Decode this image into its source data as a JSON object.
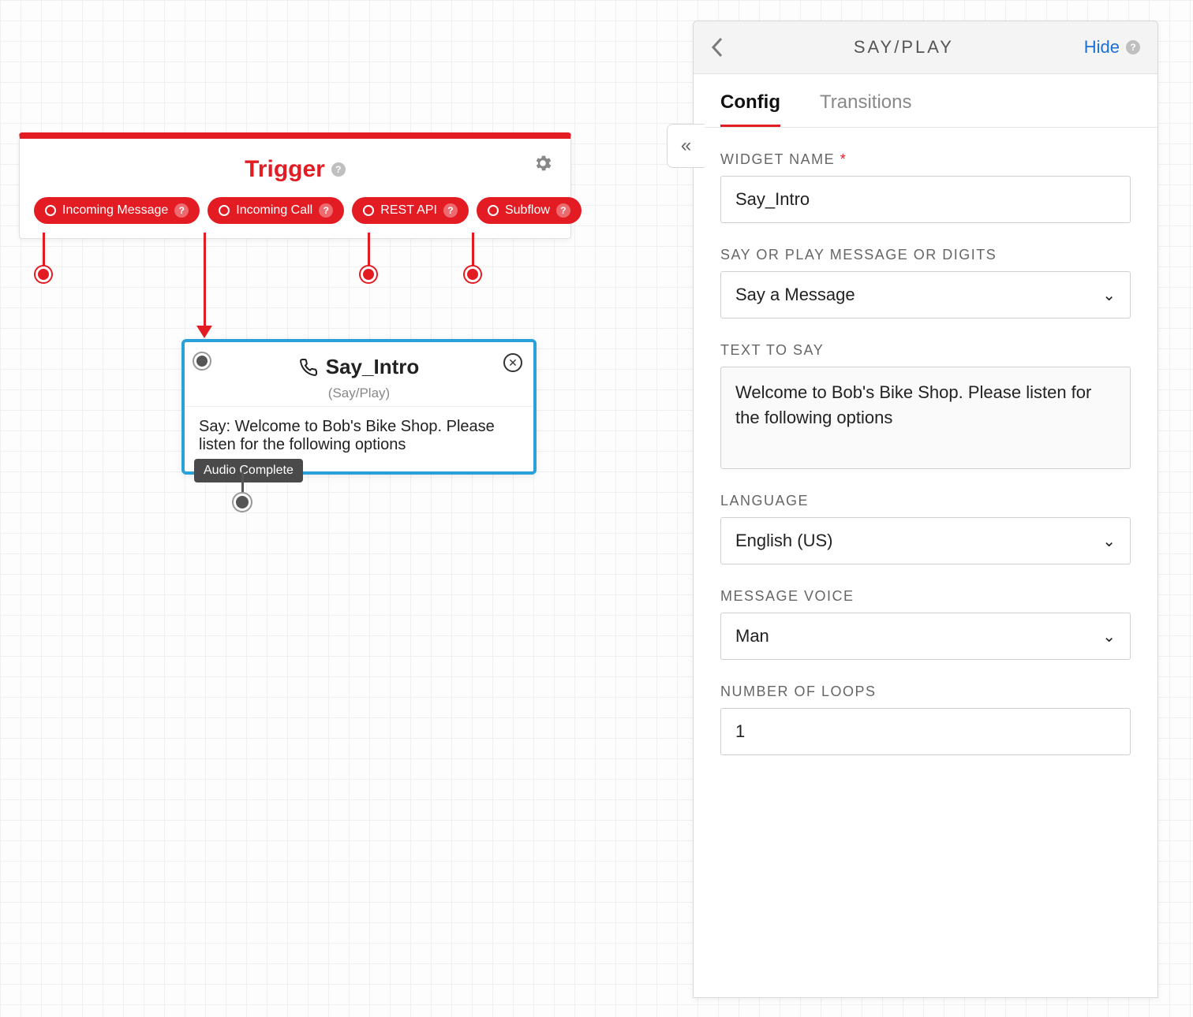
{
  "colors": {
    "accent": "#e31b23",
    "selected": "#2aa1d8",
    "link": "#1d6fd6"
  },
  "canvas": {
    "trigger": {
      "title": "Trigger",
      "events": [
        {
          "label": "Incoming Message"
        },
        {
          "label": "Incoming Call"
        },
        {
          "label": "REST API"
        },
        {
          "label": "Subflow"
        }
      ]
    },
    "say_widget": {
      "title": "Say_Intro",
      "subtitle": "(Say/Play)",
      "body": "Say: Welcome to Bob's Bike Shop. Please listen for the following options",
      "out_label": "Audio Complete"
    }
  },
  "panel": {
    "title": "SAY/PLAY",
    "hide": "Hide",
    "tabs": {
      "config": "Config",
      "transitions": "Transitions"
    },
    "form": {
      "widget_name_label": "WIDGET NAME",
      "widget_name_value": "Say_Intro",
      "mode_label": "SAY OR PLAY MESSAGE OR DIGITS",
      "mode_value": "Say a Message",
      "text_label": "TEXT TO SAY",
      "text_value": "Welcome to Bob's Bike Shop. Please listen for the following options",
      "language_label": "LANGUAGE",
      "language_value": "English (US)",
      "voice_label": "MESSAGE VOICE",
      "voice_value": "Man",
      "loops_label": "NUMBER OF LOOPS",
      "loops_value": "1"
    }
  }
}
